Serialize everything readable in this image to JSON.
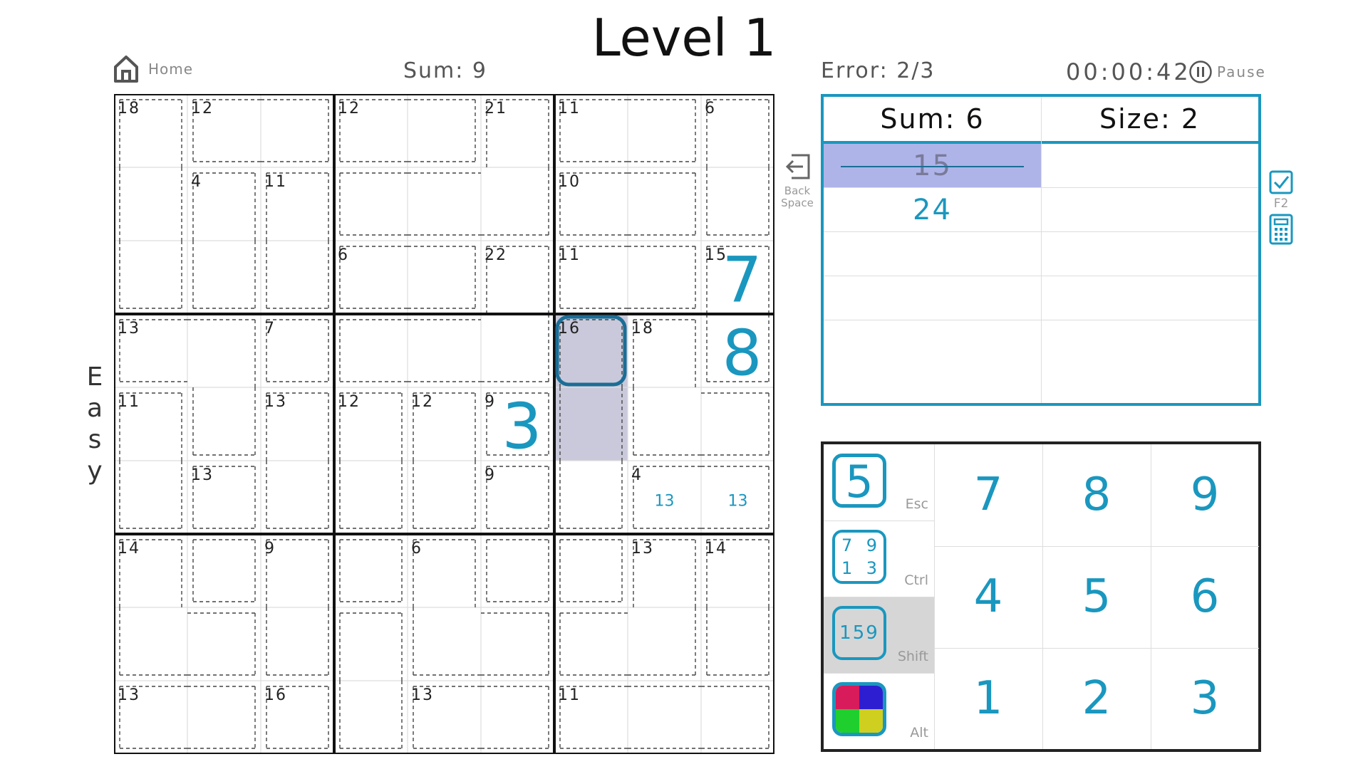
{
  "header": {
    "title": "Level 1",
    "home_label": "Home",
    "sum": "Sum: 9",
    "error": "Error: 2/3",
    "timer": "00:00:42",
    "pause_label": "Pause",
    "difficulty": [
      "E",
      "a",
      "s",
      "y"
    ]
  },
  "board": {
    "values": [
      [
        0,
        0,
        0,
        0,
        0,
        0,
        0,
        0,
        0
      ],
      [
        0,
        0,
        0,
        0,
        0,
        0,
        0,
        0,
        0
      ],
      [
        0,
        0,
        0,
        0,
        0,
        0,
        0,
        0,
        7
      ],
      [
        0,
        0,
        0,
        0,
        0,
        0,
        0,
        0,
        8
      ],
      [
        0,
        0,
        0,
        0,
        0,
        3,
        0,
        0,
        0
      ],
      [
        0,
        0,
        0,
        0,
        0,
        0,
        0,
        0,
        0
      ],
      [
        0,
        0,
        0,
        0,
        0,
        0,
        0,
        0,
        0
      ],
      [
        0,
        0,
        0,
        0,
        0,
        0,
        0,
        0,
        0
      ],
      [
        0,
        0,
        0,
        0,
        0,
        0,
        0,
        0,
        0
      ]
    ],
    "notes": [
      {
        "row": 5,
        "col": 7,
        "text": "13"
      },
      {
        "row": 5,
        "col": 8,
        "text": "13"
      }
    ],
    "selected": {
      "row": 3,
      "col": 6
    },
    "highlighted": [
      {
        "row": 3,
        "col": 6
      },
      {
        "row": 4,
        "col": 6
      }
    ],
    "cages": [
      {
        "sum": 18,
        "cells": [
          [
            0,
            0
          ],
          [
            1,
            0
          ],
          [
            2,
            0
          ]
        ]
      },
      {
        "sum": 12,
        "cells": [
          [
            0,
            1
          ],
          [
            0,
            2
          ]
        ]
      },
      {
        "sum": 12,
        "cells": [
          [
            0,
            3
          ],
          [
            0,
            4
          ]
        ]
      },
      {
        "sum": 11,
        "cells": [
          [
            0,
            6
          ],
          [
            0,
            7
          ]
        ]
      },
      {
        "sum": 6,
        "cells": [
          [
            0,
            8
          ],
          [
            1,
            8
          ]
        ]
      },
      {
        "sum": 4,
        "cells": [
          [
            1,
            1
          ],
          [
            2,
            1
          ]
        ]
      },
      {
        "sum": 11,
        "cells": [
          [
            1,
            2
          ],
          [
            2,
            2
          ]
        ]
      },
      {
        "sum": 21,
        "cells": [
          [
            0,
            5
          ],
          [
            1,
            3
          ],
          [
            1,
            4
          ],
          [
            1,
            5
          ]
        ]
      },
      {
        "sum": 10,
        "cells": [
          [
            1,
            6
          ],
          [
            1,
            7
          ]
        ]
      },
      {
        "sum": 6,
        "cells": [
          [
            2,
            3
          ],
          [
            2,
            4
          ]
        ]
      },
      {
        "sum": 11,
        "cells": [
          [
            2,
            6
          ],
          [
            2,
            7
          ]
        ]
      },
      {
        "sum": 15,
        "cells": [
          [
            2,
            8
          ],
          [
            3,
            8
          ]
        ]
      },
      {
        "sum": 13,
        "cells": [
          [
            3,
            0
          ],
          [
            3,
            1
          ],
          [
            4,
            1
          ]
        ]
      },
      {
        "sum": 7,
        "cells": [
          [
            3,
            2
          ]
        ]
      },
      {
        "sum": 22,
        "cells": [
          [
            3,
            3
          ],
          [
            3,
            4
          ],
          [
            3,
            5
          ],
          [
            2,
            5
          ]
        ]
      },
      {
        "sum": 18,
        "cells": [
          [
            3,
            7
          ],
          [
            4,
            7
          ],
          [
            4,
            8
          ]
        ]
      },
      {
        "sum": 11,
        "cells": [
          [
            4,
            0
          ],
          [
            5,
            0
          ]
        ]
      },
      {
        "sum": 13,
        "cells": [
          [
            4,
            2
          ],
          [
            5,
            2
          ]
        ]
      },
      {
        "sum": 12,
        "cells": [
          [
            4,
            3
          ],
          [
            5,
            3
          ]
        ]
      },
      {
        "sum": 12,
        "cells": [
          [
            4,
            4
          ],
          [
            5,
            4
          ]
        ]
      },
      {
        "sum": 9,
        "cells": [
          [
            4,
            5
          ]
        ]
      },
      {
        "sum": 13,
        "cells": [
          [
            5,
            1
          ]
        ]
      },
      {
        "sum": 9,
        "cells": [
          [
            5,
            5
          ]
        ]
      },
      {
        "sum": 16,
        "cells": [
          [
            5,
            6
          ],
          [
            3,
            6
          ],
          [
            4,
            6
          ]
        ]
      },
      {
        "sum": 4,
        "cells": [
          [
            5,
            7
          ],
          [
            5,
            8
          ]
        ]
      },
      {
        "sum": 14,
        "cells": [
          [
            6,
            0
          ],
          [
            7,
            0
          ],
          [
            7,
            1
          ]
        ]
      },
      {
        "sum": 9,
        "cells": [
          [
            6,
            2
          ],
          [
            7,
            2
          ]
        ]
      },
      {
        "sum": 6,
        "cells": [
          [
            6,
            4
          ],
          [
            7,
            4
          ],
          [
            7,
            5
          ]
        ]
      },
      {
        "sum": 14,
        "cells": [
          [
            6,
            8
          ],
          [
            7,
            8
          ]
        ]
      },
      {
        "sum": 13,
        "cells": [
          [
            7,
            6
          ],
          [
            7,
            7
          ],
          [
            6,
            7
          ]
        ]
      },
      {
        "sum": 13,
        "cells": [
          [
            8,
            0
          ],
          [
            8,
            1
          ]
        ]
      },
      {
        "sum": 16,
        "cells": [
          [
            8,
            2
          ]
        ]
      },
      {
        "sum": 13,
        "cells": [
          [
            8,
            4
          ],
          [
            8,
            5
          ]
        ]
      },
      {
        "sum": 11,
        "cells": [
          [
            8,
            6
          ],
          [
            8,
            7
          ],
          [
            8,
            8
          ]
        ]
      },
      {
        "cells": [
          [
            6,
            1
          ]
        ]
      },
      {
        "cells": [
          [
            6,
            3
          ]
        ]
      },
      {
        "cells": [
          [
            6,
            5
          ]
        ]
      },
      {
        "cells": [
          [
            6,
            6
          ]
        ]
      },
      {
        "cells": [
          [
            7,
            3
          ],
          [
            8,
            3
          ]
        ]
      }
    ]
  },
  "backspace": {
    "label_line1": "Back",
    "label_line2": "Space"
  },
  "combinations": {
    "sum_label": "Sum: 6",
    "size_label": "Size: 2",
    "rows": [
      {
        "left": "15",
        "left_struck": true,
        "highlighted": true,
        "right": ""
      },
      {
        "left": "24",
        "left_struck": false,
        "highlighted": false,
        "right": ""
      },
      {
        "left": "",
        "right": ""
      },
      {
        "left": "",
        "right": ""
      },
      {
        "left": "",
        "right": ""
      }
    ]
  },
  "side_tools": {
    "f2_label": "F2"
  },
  "keypad": {
    "keys": [
      [
        "7",
        "8",
        "9"
      ],
      [
        "4",
        "5",
        "6"
      ],
      [
        "1",
        "2",
        "3"
      ]
    ],
    "modes": [
      {
        "name": "mode-digit",
        "label": "Esc",
        "glyph": "5"
      },
      {
        "name": "mode-corner",
        "label": "Ctrl",
        "glyph": [
          "7",
          "9",
          "1",
          "3"
        ]
      },
      {
        "name": "mode-center",
        "label": "Shift",
        "glyph": "159",
        "active": true
      },
      {
        "name": "mode-color",
        "label": "Alt"
      }
    ]
  },
  "colors": {
    "accent": "#1a97bf",
    "highlight_cell": "#c9c9db",
    "selected_border": "#1b6e96",
    "combo_highlight": "#aeb4e8",
    "active_mode_bg": "#d6d6d6",
    "color_mode": [
      "#d81b5a",
      "#2d1fd1",
      "#1fcf2d",
      "#cfcf1f"
    ]
  }
}
